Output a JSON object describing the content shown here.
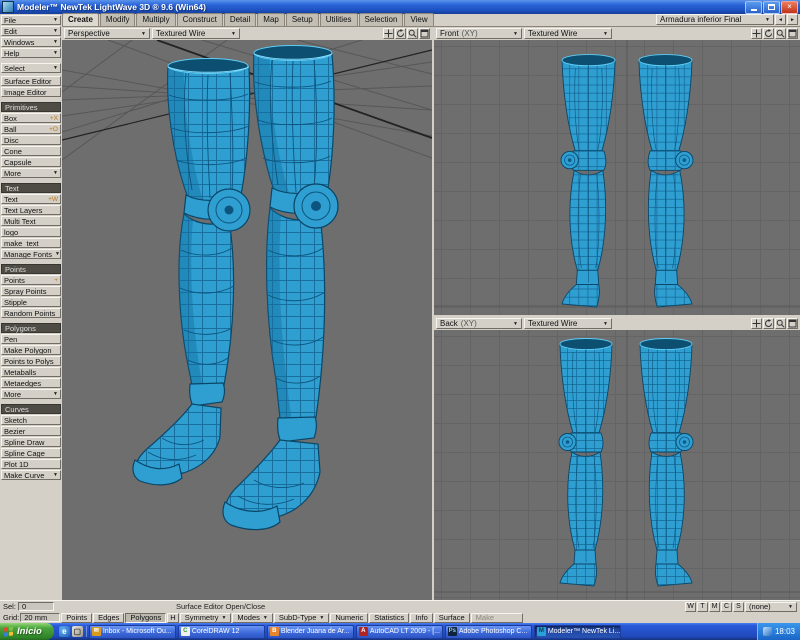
{
  "titlebar": {
    "title": "Modeler™ NewTek LightWave 3D ® 9.6  (Win64)"
  },
  "icons": {
    "chevron_down": "▼",
    "spin_left": "◄",
    "spin_right": "►",
    "close": "×"
  },
  "tabs": {
    "items": [
      "Create",
      "Modify",
      "Multiply",
      "Construct",
      "Detail",
      "Map",
      "Setup",
      "Utilities",
      "Selection",
      "View"
    ],
    "active": "Create",
    "preset": "Armadura inferior Final"
  },
  "sidebar": {
    "menus": [
      "File",
      "Edit",
      "Windows",
      "Help"
    ],
    "select_label": "Select",
    "surface_editor": "Surface Editor",
    "image_editor": "Image Editor",
    "sections": [
      {
        "title": "Primitives",
        "items": [
          {
            "label": "Box",
            "key": "+X"
          },
          {
            "label": "Ball",
            "key": "+O"
          },
          {
            "label": "Disc"
          },
          {
            "label": "Cone"
          },
          {
            "label": "Capsule"
          },
          {
            "label": "More",
            "dropdown": true
          }
        ]
      },
      {
        "title": "Text",
        "items": [
          {
            "label": "Text",
            "key": "+W"
          },
          {
            "label": "Text Layers"
          },
          {
            "label": "Multi Text"
          },
          {
            "label": "logo"
          },
          {
            "label": "make_text"
          },
          {
            "label": "Manage Fonts",
            "dropdown": true
          }
        ]
      },
      {
        "title": "Points",
        "items": [
          {
            "label": "Points",
            "key": "+"
          },
          {
            "label": "Spray Points"
          },
          {
            "label": "Stipple"
          },
          {
            "label": "Random Points"
          }
        ]
      },
      {
        "title": "Polygons",
        "items": [
          {
            "label": "Pen"
          },
          {
            "label": "Make Polygon"
          },
          {
            "label": "Points to Polys"
          },
          {
            "label": "Metaballs"
          },
          {
            "label": "Metaedges"
          },
          {
            "label": "More",
            "dropdown": true
          }
        ]
      },
      {
        "title": "Curves",
        "items": [
          {
            "label": "Sketch"
          },
          {
            "label": "Bezier"
          },
          {
            "label": "Spline Draw"
          },
          {
            "label": "Spline Cage"
          },
          {
            "label": "Plot 1D"
          },
          {
            "label": "Make Curve",
            "dropdown": true
          }
        ]
      }
    ]
  },
  "viewports": [
    {
      "view": "Perspective",
      "mode": "Textured Wire"
    },
    {
      "view": "Front",
      "axis": "(XY)",
      "mode": "Textured Wire"
    },
    {
      "view": "Back",
      "axis": "(XY)",
      "mode": "Textured Wire"
    }
  ],
  "status": {
    "sel_label": "Sel:",
    "sel_value": "0",
    "hint": "Surface Editor Open/Close",
    "vmap_buttons": [
      "W",
      "T",
      "M",
      "C",
      "S"
    ],
    "vmap_current": "(none)",
    "grid_label": "Grid:",
    "grid_value": "20 mm",
    "mode_buttons": [
      "Points",
      "Edges",
      "Polygons"
    ],
    "h_button": "H",
    "tool_buttons": [
      "Symmetry",
      "Modes",
      "SubD-Type",
      "Numeric",
      "Statistics",
      "Info",
      "Surface"
    ],
    "make_button": "Make"
  },
  "taskbar": {
    "start": "Inicio",
    "apps": [
      "Inbox - Microsoft Ou...",
      "CorelDRAW 12",
      "Blender Juana de Ar...",
      "AutoCAD LT 2009 - [...",
      "Adobe Photoshop C...",
      "Modeler™ NewTek Li..."
    ],
    "active_app": "Modeler™ NewTek Li...",
    "time": "18:03"
  },
  "colors": {
    "model_fill": "#2f9fd2",
    "model_wire": "#0d5a88",
    "viewport_bg": "#6e6e6e",
    "taskbar_blue": "#2a5ad8",
    "start_green": "#2f8428"
  }
}
